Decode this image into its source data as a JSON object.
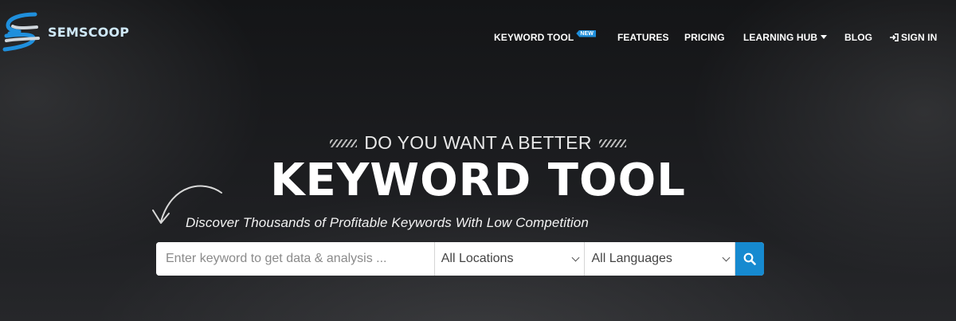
{
  "brand": {
    "name": "SEMSCOOP",
    "icon": "semscoop-logo-icon"
  },
  "nav": {
    "items": [
      {
        "label": "KEYWORD TOOL",
        "badge": "NEW"
      },
      {
        "label": "FEATURES"
      },
      {
        "label": "PRICING"
      },
      {
        "label": "LEARNING HUB",
        "icon": "caret-down-icon"
      },
      {
        "label": "BLOG"
      },
      {
        "label": "SIGN IN",
        "icon": "sign-in-icon"
      }
    ]
  },
  "hero": {
    "eyebrow": "DO YOU WANT A BETTER",
    "headline": "KEYWORD TOOL",
    "subline": "Discover Thousands of Profitable Keywords With Low Competition"
  },
  "search": {
    "keyword_placeholder": "Enter keyword to get data & analysis ...",
    "keyword_value": "",
    "location_selected": "All Locations",
    "language_selected": "All Languages",
    "button_icon": "search-icon"
  },
  "colors": {
    "accent": "#168ad0",
    "badge": "#1f8fdc",
    "background": "#1a1b1d"
  }
}
